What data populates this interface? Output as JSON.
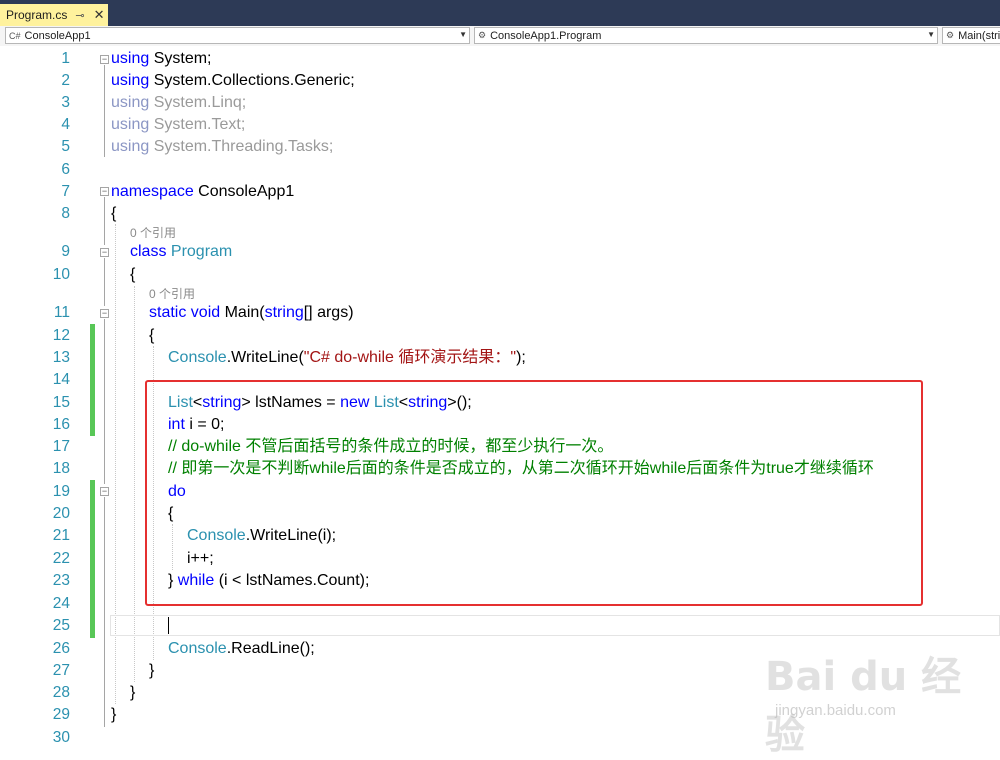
{
  "tab": {
    "title": "Program.cs",
    "pin": "⊸",
    "close": "✕"
  },
  "navbar": {
    "project": "ConsoleApp1",
    "class": "ConsoleApp1.Program",
    "member": "Main(stri",
    "project_icon": "C#"
  },
  "editor": {
    "line_numbers": [
      "1",
      "2",
      "3",
      "4",
      "5",
      "6",
      "7",
      "8",
      "9",
      "10",
      "11",
      "12",
      "13",
      "14",
      "15",
      "16",
      "17",
      "18",
      "19",
      "20",
      "21",
      "22",
      "23",
      "24",
      "25",
      "26",
      "27",
      "28",
      "29",
      "30"
    ],
    "lens_text": "0 个引用",
    "code": {
      "l1": {
        "kw": "using",
        "rest": " System;"
      },
      "l2": {
        "kw": "using",
        "rest": " System.Collections.Generic;"
      },
      "l3": {
        "kw": "using",
        "rest": " System.Linq;"
      },
      "l4": {
        "kw": "using",
        "rest": " System.Text;"
      },
      "l5": {
        "kw": "using",
        "rest": " System.Threading.Tasks;"
      },
      "l7": {
        "kw": "namespace",
        "rest": " ConsoleApp1"
      },
      "l8": "{",
      "l9": {
        "kw": "class",
        "type": "Program"
      },
      "l10": "{",
      "l11": {
        "kw1": "static",
        "kw2": "void",
        "name": " Main(",
        "kw3": "string",
        "rest": "[] args)"
      },
      "l12": "{",
      "l13": {
        "type": "Console",
        "call": ".WriteLine(",
        "str": "\"C# do-while 循环演示结果：\"",
        "end": ");"
      },
      "l15": {
        "type1": "List",
        "lt": "<",
        "kw1": "string",
        "mid": "> lstNames = ",
        "kw2": "new",
        "type2": "List",
        "kw3": "string",
        "end": ">();"
      },
      "l16": {
        "kw": "int",
        "rest": " i = 0;"
      },
      "l17": "// do-while 不管后面括号的条件成立的时候，都至少执行一次。",
      "l18": "// 即第一次是不判断while后面的条件是否成立的，从第二次循环开始while后面条件为true才继续循环",
      "l19": "do",
      "l20": "{",
      "l21": {
        "type": "Console",
        "rest": ".WriteLine(i);"
      },
      "l22": "i++;",
      "l23": {
        "pre": "} ",
        "kw": "while",
        "rest": " (i < lstNames.Count);"
      },
      "l26": {
        "type": "Console",
        "rest": ".ReadLine();"
      },
      "l27": "}",
      "l28": "}",
      "l29": "}"
    }
  },
  "watermark": {
    "brand": "Bai du 经验",
    "url": "jingyan.baidu.com"
  },
  "colors": {
    "keyword": "#0000ff",
    "type": "#2b91af",
    "string": "#a31515",
    "comment": "#008000",
    "highlight_box": "#e53030",
    "tab_active": "#fff29d"
  }
}
